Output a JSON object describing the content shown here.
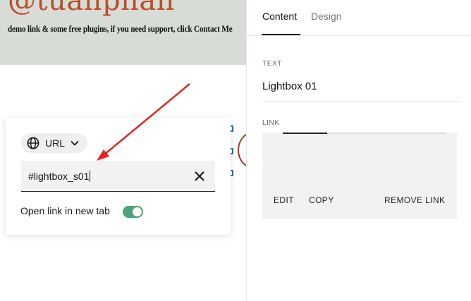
{
  "page": {
    "brand": "@tuanphan",
    "tagline": "demo link & some free plugins, if you need support, click Contact Me"
  },
  "popover": {
    "link_type": "URL",
    "link_type_icon": "globe-icon",
    "url_value": "#lightbox_s01",
    "clear_icon": "close-icon",
    "new_tab_label": "Open link in new tab",
    "new_tab_enabled": true
  },
  "panel": {
    "tabs": [
      {
        "label": "Content",
        "active": true
      },
      {
        "label": "Design",
        "active": false
      }
    ],
    "text_label": "TEXT",
    "text_value": "Lightbox 01",
    "link_label": "LINK",
    "link_actions": {
      "edit": "EDIT",
      "copy": "COPY",
      "remove": "REMOVE LINK"
    }
  },
  "colors": {
    "accent_toggle": "#4aa37a",
    "annotation_arrow": "#e02424",
    "brand": "#b64f2c",
    "banner_bg": "#d7dcd6"
  }
}
